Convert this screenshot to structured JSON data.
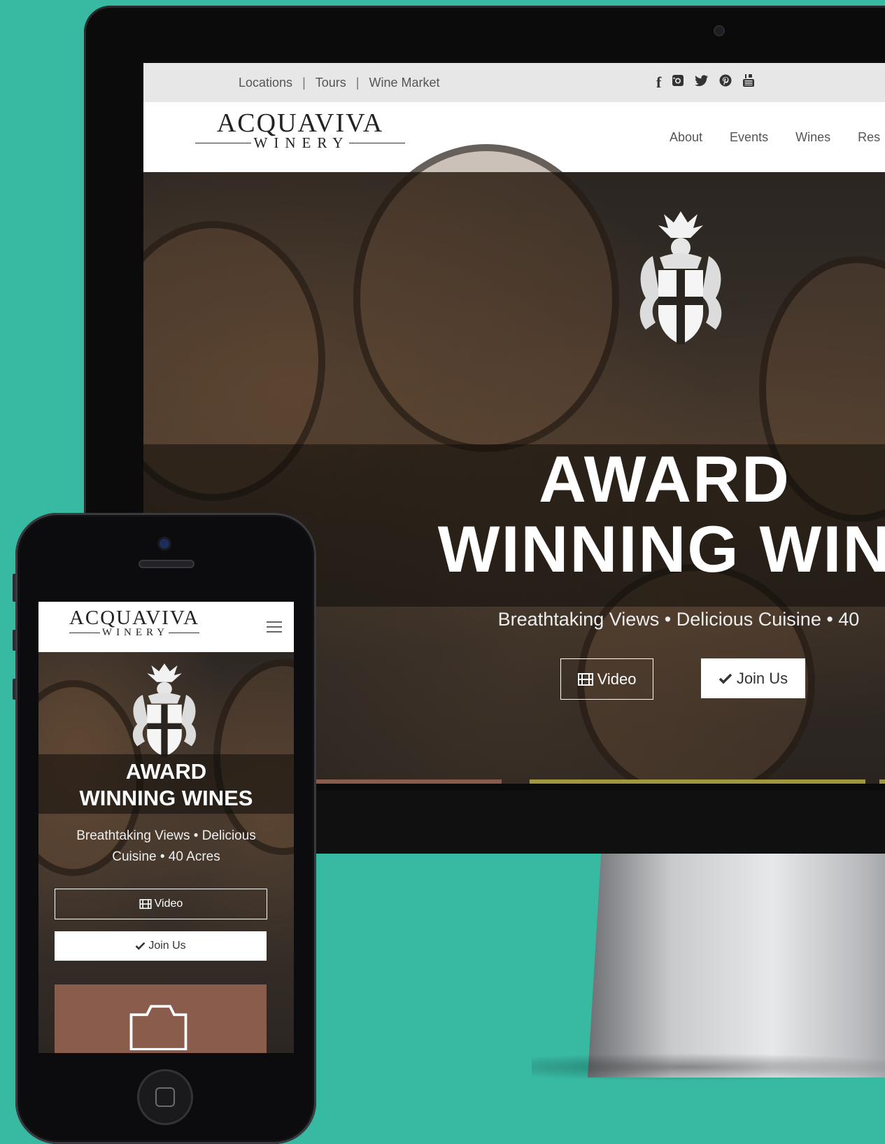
{
  "desktop": {
    "topbar": {
      "links": [
        "Locations",
        "Tours",
        "Wine Market"
      ],
      "separator": "|",
      "social_icons": [
        "facebook-icon",
        "instagram-icon",
        "twitter-icon",
        "pinterest-icon",
        "youtube-icon"
      ]
    },
    "logo": {
      "line1": "ACQUAVIVA",
      "line2": "WINERY"
    },
    "nav": [
      "About",
      "Events",
      "Wines",
      "Res"
    ],
    "hero": {
      "headline_line1": "AWARD",
      "headline_line2": "WINNING WIN",
      "subline": "Breathtaking Views • Delicious Cuisine • 40",
      "video_label": "Video",
      "join_label": "Join Us"
    },
    "tiles": [
      {
        "color": "#8a5c4c",
        "icon": "camera-icon"
      },
      {
        "color": "#9f963f",
        "icon": "rings-icon"
      }
    ]
  },
  "mobile": {
    "logo": {
      "line1": "ACQUAVIVA",
      "line2": "WINERY"
    },
    "hero": {
      "headline_line1": "AWARD",
      "headline_line2": "WINNING WINES",
      "subline": "Breathtaking Views • Delicious Cuisine • 40 Acres",
      "video_label": "Video",
      "join_label": "Join Us"
    }
  },
  "colors": {
    "background": "#38b9a2",
    "tile_brown": "#8a5c4c",
    "tile_olive": "#9f963f"
  }
}
